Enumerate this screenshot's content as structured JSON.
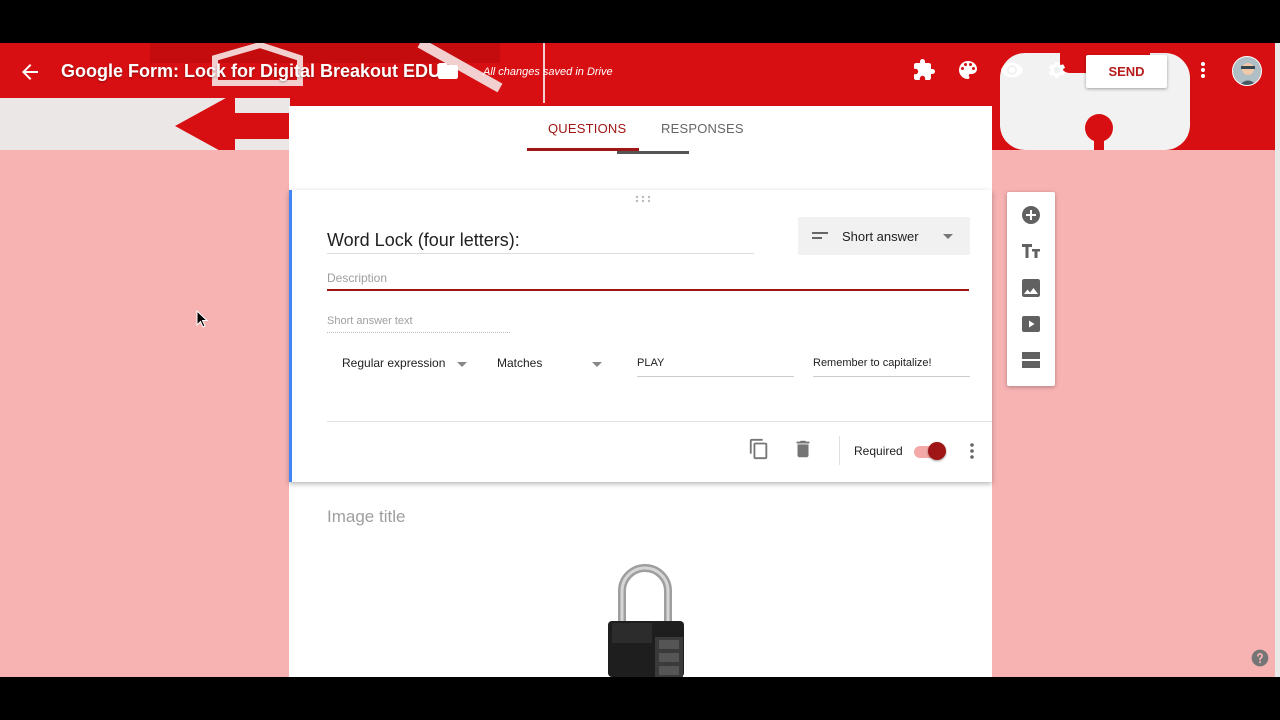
{
  "header": {
    "form_title": "Google Form: Lock for Digital Breakout EDU",
    "saved_status": "All changes saved in Drive",
    "send_label": "SEND",
    "icons": [
      "arrow-back-icon",
      "folder-icon",
      "puzzle-icon",
      "palette-icon",
      "eye-icon",
      "gear-icon",
      "more-vert-icon",
      "avatar"
    ]
  },
  "tabs": [
    {
      "label": "QUESTIONS",
      "active": true
    },
    {
      "label": "RESPONSES",
      "active": false
    }
  ],
  "question": {
    "title": "Word Lock (four letters):",
    "type": "Short answer",
    "description_placeholder": "Description",
    "short_answer_placeholder": "Short answer text",
    "validation": {
      "rule": "Regular expression",
      "condition": "Matches",
      "pattern": "PLAY",
      "error_text": "Remember to capitalize!"
    },
    "required_label": "Required",
    "required": true
  },
  "image_item": {
    "title_placeholder": "Image title"
  },
  "side_toolbar": [
    "add-question-icon",
    "add-title-icon",
    "add-image-icon",
    "add-video-icon",
    "add-section-icon"
  ],
  "colors": {
    "header_red": "#d80f12",
    "page_bg": "#f7b2b2",
    "accent": "#a01515",
    "active_card_border": "#4285f4"
  }
}
